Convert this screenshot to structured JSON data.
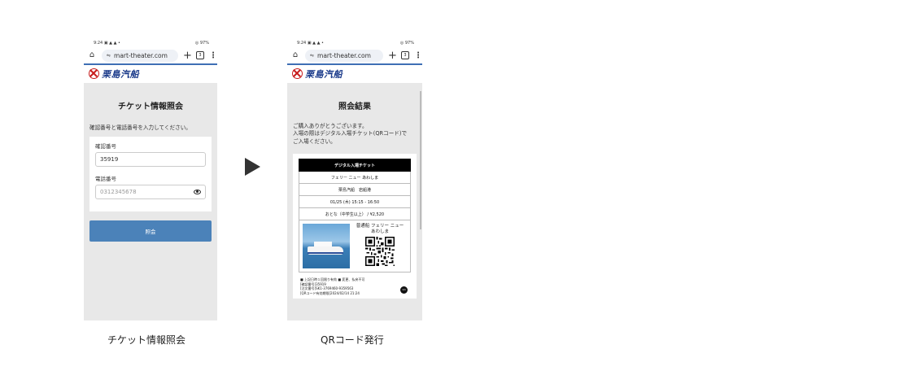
{
  "status_bar": {
    "time": "9:24",
    "notif_icons": "▣ ▲ ▲ •",
    "right": "◎ 97%"
  },
  "browser": {
    "url": "mart-theater.com",
    "tabs_count": "3"
  },
  "brand": {
    "name": "栗島汽船",
    "color": "#1a3a8a"
  },
  "screen1": {
    "title": "チケット情報照会",
    "description": "確認番号と電話番号を入力してください。",
    "confirm_label": "確認番号",
    "confirm_value": "35919",
    "phone_label": "電話番号",
    "phone_placeholder": "0312345678",
    "submit_label": "照会"
  },
  "screen2": {
    "title": "照会結果",
    "description_line1": "ご購入ありがとうございます。",
    "description_line2": "入場の際はデジタル入場チケット(QRコード)で",
    "description_line3": "ご入場ください。",
    "ticket": {
      "header": "デジタル入場チケット",
      "ship": "フェリー ニュー あわしま",
      "company_port": "栗島汽船　岩船港",
      "datetime": "01/25 (木) 15:15 - 16:50",
      "fare": "おとな（中学生以上） / ¥2,520",
      "vessel_line1": "普通船 フェリー ニュー",
      "vessel_line2": "あわしま",
      "note1": "■ 上記日時１回限り有効 ■ 変更、払戻不可",
      "note2": "[確認番号]35919",
      "note3": "[注文番号]SK1-3769460-9359563",
      "note4": "[QRコード有効期限]2024/02/14 21:24",
      "badge": "1/1"
    }
  },
  "captions": {
    "left": "チケット情報照会",
    "right": "QRコード発行"
  }
}
